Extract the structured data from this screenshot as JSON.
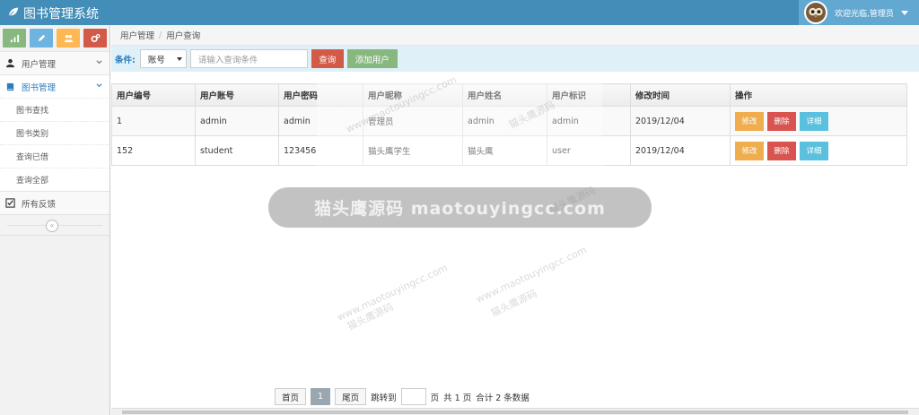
{
  "header": {
    "title": "图书管理系统",
    "welcome": "欢迎光临,管理员"
  },
  "shortcuts": [
    {
      "icon": "signal-icon",
      "color": "#87b87f"
    },
    {
      "icon": "pencil-icon",
      "color": "#6fb3e0"
    },
    {
      "icon": "users-icon",
      "color": "#ffb752"
    },
    {
      "icon": "cogs-icon",
      "color": "#d15b47"
    }
  ],
  "sidebar": {
    "user_mgmt": "用户管理",
    "book_mgmt": "图书管理",
    "sub_items": [
      "图书查找",
      "图书类别",
      "查询已借",
      "查询全部"
    ],
    "feedback": "所有反馈",
    "collapse_glyph": "«"
  },
  "breadcrumb": [
    "用户管理",
    "用户查询"
  ],
  "filter": {
    "label": "条件:",
    "select_value": "账号",
    "placeholder": "请输入查询条件",
    "search_btn": "查询",
    "add_btn": "添加用户"
  },
  "table": {
    "headers": [
      "用户编号",
      "用户账号",
      "用户密码",
      "用户昵称",
      "用户姓名",
      "用户标识",
      "修改时间",
      "操作"
    ],
    "rows": [
      [
        "1",
        "admin",
        "admin",
        "管理员",
        "admin",
        "admin",
        "2019/12/04"
      ],
      [
        "152",
        "student",
        "123456",
        "猫头鹰学生",
        "猫头鹰",
        "user",
        "2019/12/04"
      ]
    ],
    "actions": {
      "edit": "修改",
      "delete": "删除",
      "detail": "详细"
    }
  },
  "watermark": {
    "main": "猫头鹰源码 maotouyingcc.com",
    "small": "猫头鹰源码",
    "url": "www.maotouyingcc.com"
  },
  "pager": {
    "first": "首页",
    "current": "1",
    "last": "尾页",
    "goto": "跳转到",
    "page_unit": "页",
    "total_pages": "共 1 页",
    "total_items": "合计 2 条数据"
  }
}
